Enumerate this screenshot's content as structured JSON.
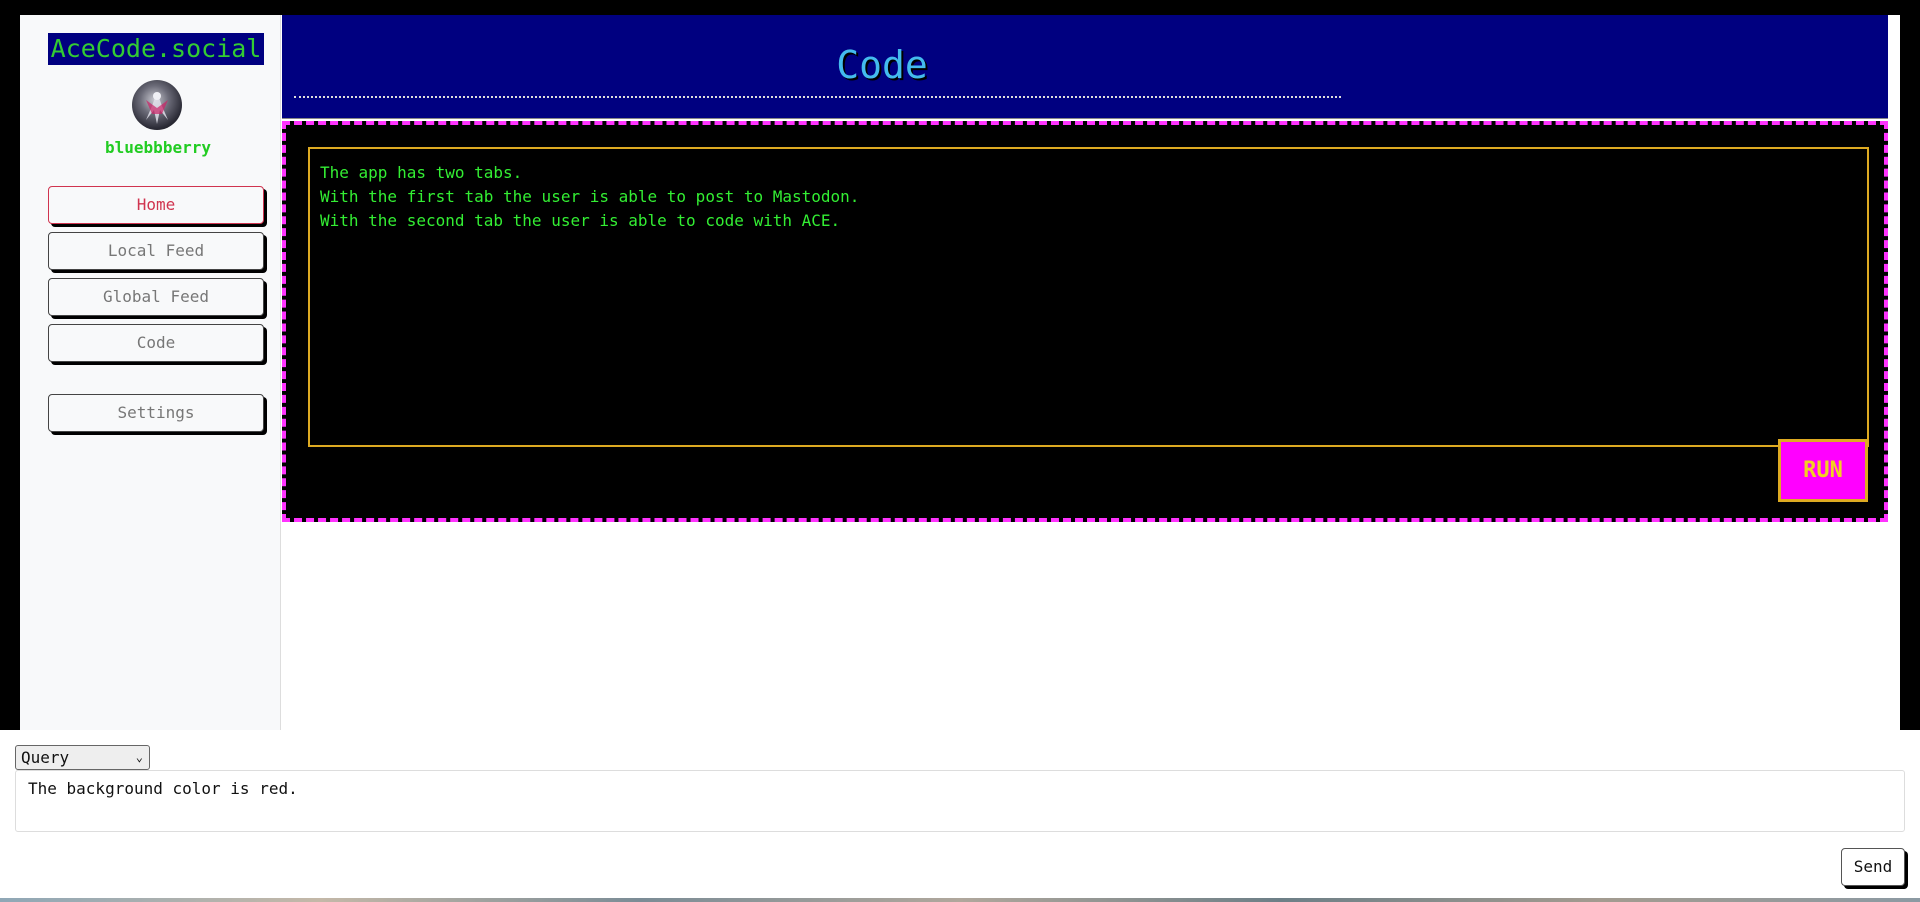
{
  "app": {
    "brand": "AceCode.social",
    "username": "bluebbberry"
  },
  "sidebar": {
    "items": [
      {
        "label": "Home",
        "active": true
      },
      {
        "label": "Local Feed",
        "active": false
      },
      {
        "label": "Global Feed",
        "active": false
      },
      {
        "label": "Code",
        "active": false
      },
      {
        "label": "Settings",
        "active": false
      }
    ]
  },
  "header": {
    "title": "Code"
  },
  "editor": {
    "content": "The app has two tabs.\nWith the first tab the user is able to post to Mastodon.\nWith the second tab the user is able to code with ACE.",
    "run_label": "RUN"
  },
  "bottom": {
    "mode_selected": "Query",
    "query_text": "The background color is red.",
    "send_label": "Send"
  },
  "colors": {
    "header_bg": "#000080",
    "brand_text": "#33cc33",
    "editor_text": "#33ee33",
    "editor_border": "#ddaa22",
    "panel_border": "#ff33ff",
    "run_bg": "#ff00ff",
    "active_nav": "#d0344f"
  }
}
